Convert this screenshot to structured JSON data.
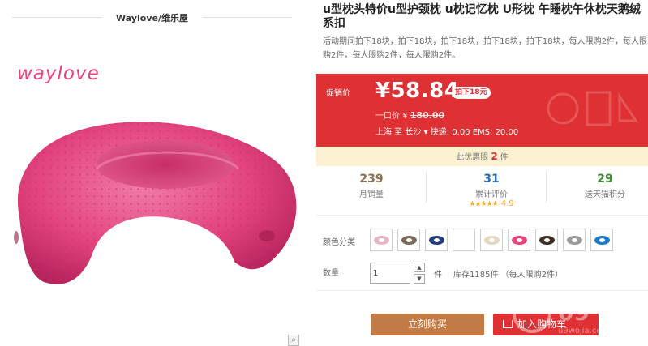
{
  "shop": {
    "name": "Waylove/维乐屋"
  },
  "image": {
    "logo_text": "waylove"
  },
  "product": {
    "title": "u型枕头特价u型护颈枕 u枕记忆枕 U形枕 午睡枕午休枕天鹅绒系扣",
    "subtitle": "活动期间拍下18块，拍下18块，拍下18块，拍下18块，拍下18块，每人限购2件，每人限购2件，每人限购2件，每人限购2件。"
  },
  "promo": {
    "label": "促销价",
    "price": "¥58.84",
    "badge": "拍下18元",
    "orig_label": "一口价 ¥",
    "orig_price": "180.00",
    "shipping": "上海  至  长沙 ▾  快递: 0.00 EMS: 20.00",
    "bg_color": "#df3033"
  },
  "limit": {
    "prefix": "此优惠限",
    "count": "2",
    "suffix": "件"
  },
  "stats": {
    "sales": {
      "num": "239",
      "label": "月销量"
    },
    "reviews": {
      "num": "31",
      "label": "累计评价",
      "stars": "★★★★★",
      "rating": "4.9"
    },
    "points": {
      "num": "29",
      "label": "送天猫积分"
    }
  },
  "color": {
    "label": "颜色分类",
    "options": [
      {
        "name": "light-pink",
        "color": "#e8b6c8"
      },
      {
        "name": "coffee",
        "color": "#7d6a58"
      },
      {
        "name": "navy",
        "color": "#233c7a"
      },
      {
        "name": "blank",
        "color": "#ffffff"
      },
      {
        "name": "beige",
        "color": "#e6d8bf"
      },
      {
        "name": "rose",
        "color": "#e8437f"
      },
      {
        "name": "dark-brown",
        "color": "#3e2f26"
      },
      {
        "name": "grey",
        "color": "#9a9a9a"
      },
      {
        "name": "blue",
        "color": "#1e78c8"
      }
    ]
  },
  "quantity": {
    "label": "数量",
    "value": "1",
    "unit": "件",
    "stock": "库存1185件 （每人限购2件）"
  },
  "buttons": {
    "buy": "立刻购买",
    "cart": "加入购物车"
  },
  "watermark": {
    "text": "09",
    "sub": "u9wojia.com"
  }
}
